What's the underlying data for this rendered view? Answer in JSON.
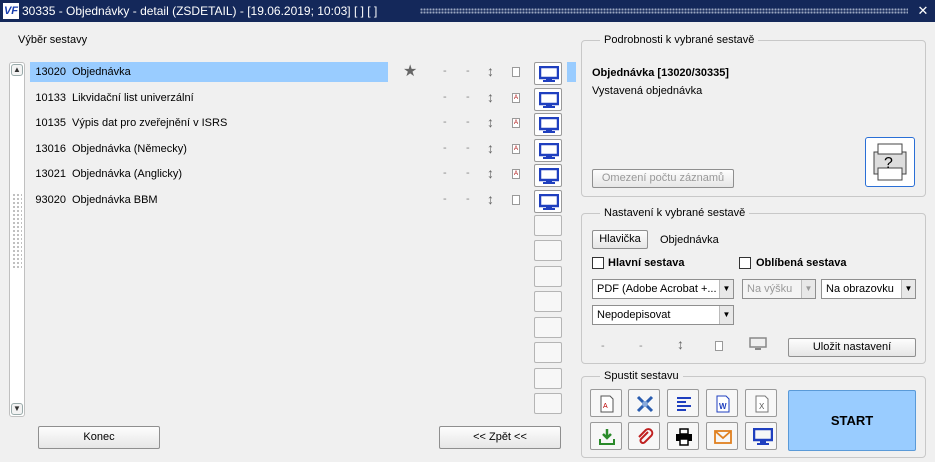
{
  "window": {
    "title": "30335 - Objednávky - detail (ZSDETAIL) - [19.06.2019; 10:03]  [ ]  [ ]",
    "close": "✕"
  },
  "left": {
    "legend": "Výběr sestavy",
    "rows": [
      {
        "code": "13020",
        "name": "Objednávka",
        "d1": "-",
        "d2": "-"
      },
      {
        "code": "10133",
        "name": "Likvidační list univerzální",
        "d1": "-",
        "d2": "-"
      },
      {
        "code": "10135",
        "name": "Výpis dat pro zveřejnění v ISRS",
        "d1": "-",
        "d2": "-"
      },
      {
        "code": "13016",
        "name": "Objednávka (Německy)",
        "d1": "-",
        "d2": "-"
      },
      {
        "code": "13021",
        "name": "Objednávka (Anglicky)",
        "d1": "-",
        "d2": "-"
      },
      {
        "code": "93020",
        "name": "Objednávka BBM",
        "d1": "-",
        "d2": "-"
      }
    ],
    "konec": "Konec",
    "zpet": "<< Zpět <<"
  },
  "detail": {
    "legend": "Podrobnosti k vybrané sestavě",
    "title": "Objednávka [13020/30335]",
    "desc": "Vystavená objednávka",
    "omezeni": "Omezení počtu záznamů"
  },
  "settings": {
    "legend": "Nastavení k vybrané sestavě",
    "hlavicka": "Hlavička",
    "hlavicka_val": "Objednávka",
    "hlavni": "Hlavní sestava",
    "oblibena": "Oblíbená sestava",
    "format": "PDF (Adobe Acrobat +...",
    "orient": "Na výšku",
    "output": "Na obrazovku",
    "sign": "Nepodepisovat",
    "d1": "-",
    "d2": "-",
    "ulozit": "Uložit nastavení"
  },
  "run": {
    "legend": "Spustit sestavu",
    "start": "START"
  },
  "colors": {
    "title_bg": "#14285a",
    "selected": "#99ccff",
    "start_bg": "#99ccff",
    "monitor": "#1f3fbf"
  }
}
